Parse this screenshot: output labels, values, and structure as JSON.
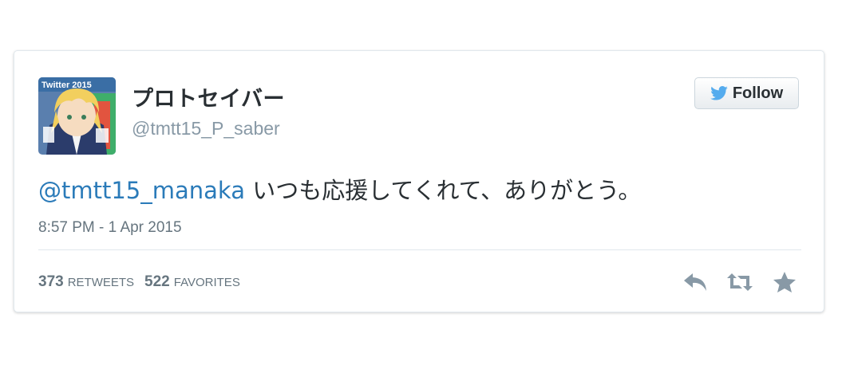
{
  "tweet": {
    "display_name": "プロトセイバー",
    "handle": "@tmtt15_P_saber",
    "mention": "@tmtt15_manaka",
    "text": " いつも応援してくれて、ありがとう。",
    "timestamp": "8:57 PM - 1 Apr 2015",
    "avatar_caption": "Twitter 2015"
  },
  "follow_button": {
    "label": "Follow",
    "icon": "twitter-bird-icon"
  },
  "stats": {
    "retweets_count": "373",
    "retweets_label": "RETWEETS",
    "favorites_count": "522",
    "favorites_label": "FAVORITES"
  },
  "actions": [
    {
      "icon": "reply-icon"
    },
    {
      "icon": "retweet-icon"
    },
    {
      "icon": "favorite-star-icon"
    }
  ],
  "colors": {
    "link": "#2b7bb9",
    "twitter_blue": "#55acee",
    "text": "#292f33",
    "muted": "#8899a6"
  }
}
